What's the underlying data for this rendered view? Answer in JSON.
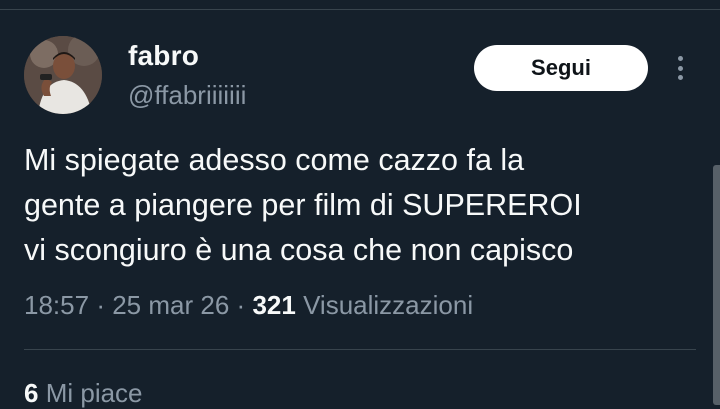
{
  "author": {
    "display_name": "fabro",
    "handle": "@ffabriiiiiii"
  },
  "actions": {
    "follow_label": "Segui"
  },
  "tweet": {
    "text": "Mi spiegate adesso come cazzo fa la\ngente a piangere per film di SUPEREROI\nvi scongiuro è una cosa che non capisco"
  },
  "meta": {
    "time": "18:57",
    "separator": "·",
    "date": "25 mar 26",
    "views_count": "321",
    "views_label": "Visualizzazioni"
  },
  "stats": {
    "likes_count": "6",
    "likes_label": "Mi piace"
  },
  "icons": {
    "more": "more-vertical-icon",
    "avatar": "avatar-image"
  },
  "colors": {
    "background": "#15202b",
    "text_primary": "#f7f9f9",
    "text_secondary": "#8b98a5",
    "divider": "#38444d",
    "button_bg": "#ffffff",
    "button_text": "#0f1419"
  }
}
